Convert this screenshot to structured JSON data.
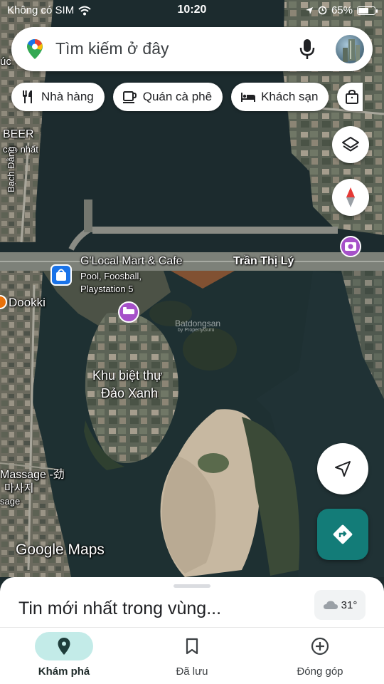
{
  "status_bar": {
    "carrier": "Không có SIM",
    "time": "10:20",
    "battery": "65%",
    "battery_level": 0.65
  },
  "search": {
    "placeholder": "Tìm kiếm ở đây",
    "icons": [
      "google-maps-pin-icon",
      "microphone-icon"
    ]
  },
  "chips": [
    {
      "label": "Nhà hàng",
      "icon": "restaurant-icon"
    },
    {
      "label": "Quán cà phê",
      "icon": "coffee-icon"
    },
    {
      "label": "Khách sạn",
      "icon": "hotel-icon"
    },
    {
      "label": "",
      "icon": "shopping-bag-icon"
    }
  ],
  "map": {
    "labels": {
      "beer": "BEER",
      "cao_nhat": "cao nhất",
      "bach_dang": "Bạch Đằng",
      "tran_thi_ly": "Trần Thị Lý",
      "glocal_title": "G'Local Mart & Cafe",
      "glocal_sub1": "Pool, Foosball,",
      "glocal_sub2": "Playstation 5",
      "dookki": "Dookki",
      "island_line1": "Khu biệt thự",
      "island_line2": "Đảo Xanh",
      "massage": "Massage -劲",
      "massage_ko": "마사지",
      "massage_partial": "sage",
      "watermark": "Batdongsan",
      "watermark_sub": "by PropertyGuru",
      "google_maps": "Google Maps",
      "top_left": "úc"
    },
    "controls": [
      "layers-icon",
      "compass-icon",
      "my-location-icon",
      "directions-icon"
    ],
    "colors": {
      "water": "#1c2b2e",
      "land": "#555b4f",
      "sand": "#c7b8a1",
      "teal_accent": "#137c78",
      "pin_magenta": "#a651c9"
    }
  },
  "sheet": {
    "title": "Tin mới nhất trong vùng...",
    "weather": "31°"
  },
  "bottom_nav": [
    {
      "label": "Khám phá",
      "icon": "explore-pin-icon",
      "active": true
    },
    {
      "label": "Đã lưu",
      "icon": "bookmark-icon",
      "active": false
    },
    {
      "label": "Đóng góp",
      "icon": "contribute-plus-icon",
      "active": false
    }
  ]
}
